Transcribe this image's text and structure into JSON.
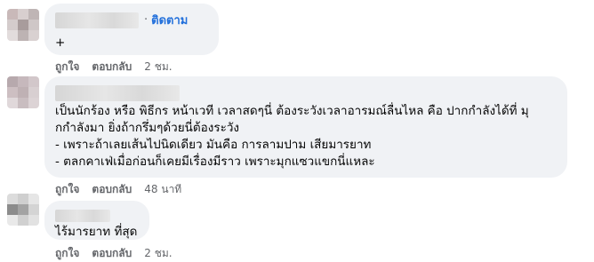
{
  "comments": [
    {
      "follow_label": "ติดตาม",
      "separator": "·",
      "text": "+",
      "like": "ถูกใจ",
      "reply": "ตอบกลับ",
      "time": "2 ชม."
    },
    {
      "text": "เป็นนักร้อง หรือ พิธีกร หน้าเวที เวลาสดๆนี่ ต้องระวังเวลาอารมณ์ลื่นไหล คือ ปากกำลังได้ที่ มุ\nกกำลังมา ยิ่งถ้ากรึ่มๆด้วยนี่ต้องระวัง\n- เพราะถ้าเลยเส้นไปนิดเดียว มันคือ การลามปาม เสียมารยาท\n- ตลกคาเฟ่เมื่อก่อนก็เคยมีเรื่องมีราว เพราะมุกแซวแขกนี่แหละ",
      "like": "ถูกใจ",
      "reply": "ตอบกลับ",
      "time": "48 นาที"
    },
    {
      "text": "ไร้มารยาท ที่สุด",
      "like": "ถูกใจ",
      "reply": "ตอบกลับ",
      "time": "2 ชม."
    }
  ],
  "colors": {
    "bubble": "#f0f2f5",
    "follow": "#216fdb",
    "meta": "#65676b"
  }
}
